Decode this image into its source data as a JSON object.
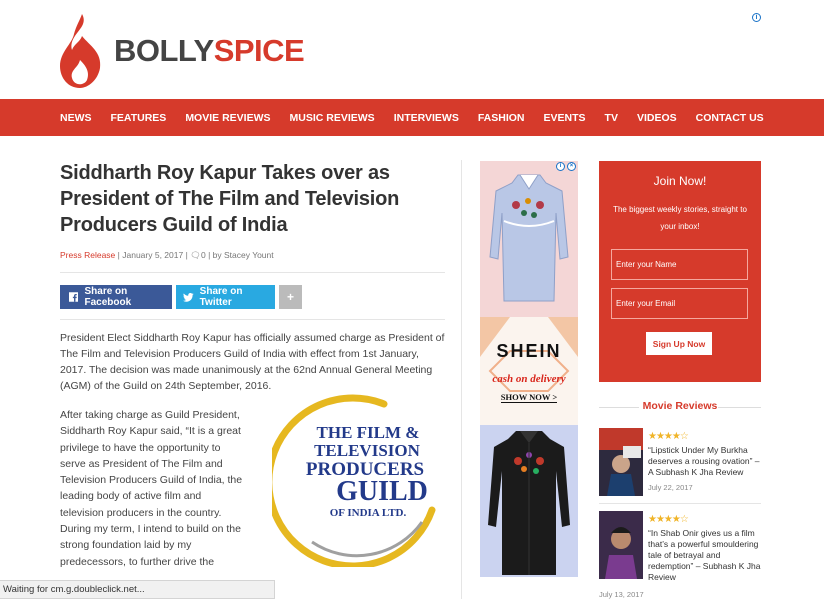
{
  "brand": {
    "part1": "BOLLY",
    "part2": "SPICE",
    "accent": "#d63a2b"
  },
  "nav": [
    "NEWS",
    "FEATURES",
    "MOVIE REVIEWS",
    "MUSIC REVIEWS",
    "INTERVIEWS",
    "FASHION",
    "EVENTS",
    "TV",
    "VIDEOS",
    "CONTACT US"
  ],
  "article": {
    "title": "Siddharth Roy Kapur Takes over as President of The Film and Television Producers Guild of India",
    "category": "Press Release",
    "date": "January 5, 2017",
    "comments": "0",
    "author_prefix": "by",
    "author": "Stacey Yount",
    "share_facebook": "Share on Facebook",
    "share_twitter": "Share on Twitter",
    "share_more": "+",
    "para1": "President Elect Siddharth Roy Kapur has officially assumed charge as President of The Film and Television Producers Guild of India with effect from 1st January, 2017. The decision was made unanimously at the 62nd Annual General Meeting (AGM) of the Guild on 24th September, 2016.",
    "para2": "After taking charge as Guild President, Siddharth Roy Kapur said, “It is a great privilege to have the opportunity to serve as President of The Film and Television Producers Guild of India, the leading body of active film and television producers in the country. During my term, I intend to build on the strong foundation laid by my predecessors, to further drive the",
    "guild_logo": {
      "line1": "THE FILM &",
      "line2": "TELEVISION",
      "line3": "PRODUCERS",
      "line4": "GUILD",
      "line5": "OF INDIA LTD."
    }
  },
  "ad": {
    "brand": "SHEIN",
    "tagline": "cash on delivery",
    "cta": "SHOW NOW >"
  },
  "newsletter": {
    "title": "Join Now!",
    "text": "The biggest weekly stories, straight to your inbox!",
    "name_placeholder": "Enter your Name",
    "email_placeholder": "Enter your Email",
    "button": "Sign Up Now"
  },
  "movie_reviews": {
    "heading": "Movie Reviews",
    "items": [
      {
        "stars": "★★★★☆",
        "rating": 4,
        "title": "“Lipstick Under My Burkha deserves a rousing ovation” – A Subhash K Jha Review",
        "date": "July 22, 2017"
      },
      {
        "stars": "★★★★☆",
        "rating": 4,
        "title": "“In Shab Onir gives us a film that’s a powerful smouldering tale of betrayal and redemption” – Subhash K Jha Review",
        "date": "July 13, 2017"
      }
    ]
  },
  "status_bar": "Waiting for cm.g.doubleclick.net..."
}
